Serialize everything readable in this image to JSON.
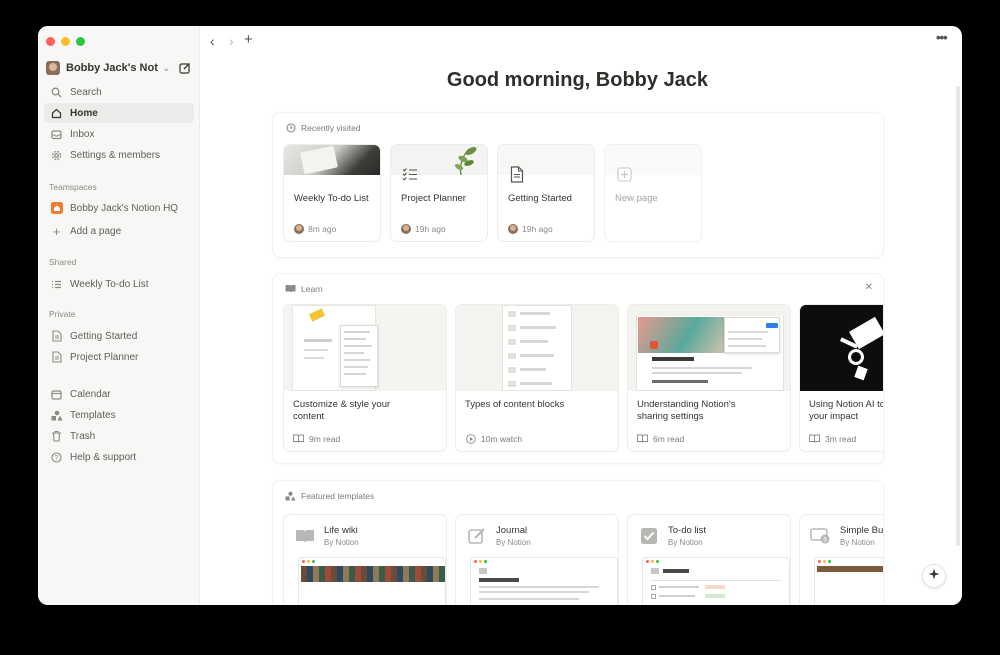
{
  "sidebar": {
    "workspace_name": "Bobby Jack's Not...",
    "nav": [
      {
        "label": "Search",
        "icon": "search-icon"
      },
      {
        "label": "Home",
        "icon": "home-icon"
      },
      {
        "label": "Inbox",
        "icon": "inbox-icon"
      },
      {
        "label": "Settings & members",
        "icon": "gear-icon"
      }
    ],
    "teamspaces_label": "Teamspaces",
    "teamspaces": [
      {
        "label": "Bobby Jack's Notion HQ",
        "icon": "home-icon"
      },
      {
        "label": "Add a page",
        "icon": "plus-icon"
      }
    ],
    "shared_label": "Shared",
    "shared": [
      {
        "label": "Weekly To-do List",
        "icon": "list-icon"
      }
    ],
    "private_label": "Private",
    "private": [
      {
        "label": "Getting Started",
        "icon": "page-icon"
      },
      {
        "label": "Project Planner",
        "icon": "page-icon"
      }
    ],
    "utilities": [
      {
        "label": "Calendar",
        "icon": "calendar-icon"
      },
      {
        "label": "Templates",
        "icon": "templates-icon"
      },
      {
        "label": "Trash",
        "icon": "trash-icon"
      },
      {
        "label": "Help & support",
        "icon": "help-icon"
      }
    ]
  },
  "main": {
    "greeting": "Good morning, Bobby Jack",
    "recent": {
      "heading": "Recently visited",
      "cards": [
        {
          "title": "Weekly To-do List",
          "time": "8m ago"
        },
        {
          "title": "Project Planner",
          "time": "19h ago"
        },
        {
          "title": "Getting Started",
          "time": "19h ago"
        },
        {
          "title": "New page",
          "time": ""
        }
      ]
    },
    "learn": {
      "heading": "Learn",
      "cards": [
        {
          "title": "Customize & style your content",
          "meta": "9m read",
          "meta_icon": "book-icon"
        },
        {
          "title": "Types of content blocks",
          "meta": "10m watch",
          "meta_icon": "play-icon"
        },
        {
          "title": "Understanding Notion's sharing settings",
          "meta": "6m read",
          "meta_icon": "book-icon"
        },
        {
          "title": "Using Notion AI to your impact",
          "meta": "3m read",
          "meta_icon": "book-icon"
        }
      ]
    },
    "templates": {
      "heading": "Featured templates",
      "cards": [
        {
          "name": "Life wiki",
          "by": "By Notion",
          "icon": "book-icon"
        },
        {
          "name": "Journal",
          "by": "By Notion",
          "icon": "pencil-icon"
        },
        {
          "name": "To-do list",
          "by": "By Notion",
          "icon": "checkbox-icon"
        },
        {
          "name": "Simple Bu",
          "by": "By Notion",
          "icon": "money-icon"
        }
      ]
    }
  },
  "colors": {
    "sidebar_bg": "#f7f7f5",
    "traffic_red": "#fe5f57",
    "traffic_yellow": "#febc2e",
    "traffic_green": "#28c840",
    "teamspace_orange": "#f07c33"
  }
}
